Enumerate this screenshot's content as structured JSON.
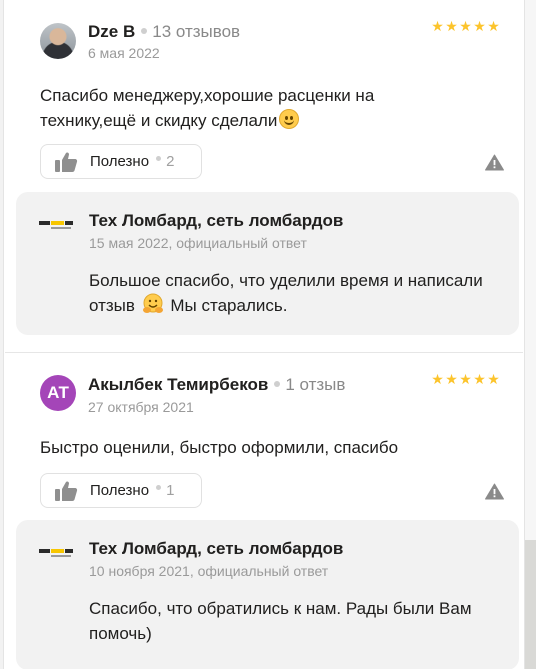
{
  "reviews": [
    {
      "author": "Dze B",
      "author_reviews": "13 отзывов",
      "date": "6 мая 2022",
      "rating": 5,
      "text": "Спасибо менеджеру,хорошие расценки на технику,ещё и скидку сделали",
      "text_emoji": "slightly-smiling-face",
      "useful_label": "Полезно",
      "useful_count": "2",
      "reply": {
        "org_name": "Тех Ломбард, сеть ломбардов",
        "date_line": "15 мая 2022, официальный ответ",
        "text_before": "Большое спасибо, что уделили время и написали отзыв",
        "text_emoji": "hugging-face",
        "text_after": "Мы старались."
      }
    },
    {
      "author": "Акылбек Темирбеков",
      "author_initials": "АТ",
      "author_reviews": "1 отзыв",
      "date": "27 октября 2021",
      "rating": 5,
      "text": "Быстро оценили, быстро оформили, спасибо",
      "useful_label": "Полезно",
      "useful_count": "1",
      "reply": {
        "org_name": "Тех Ломбард, сеть ломбардов",
        "date_line": "10 ноября 2021, официальный ответ",
        "text": "Спасибо, что обратились к нам. Рады были Вам помочь)"
      }
    }
  ],
  "colors": {
    "star": "#fcc42c",
    "avatar_initials_bg": "#a445b8",
    "reply_bg": "#f2f2f2",
    "muted_text": "#9a9a9a"
  },
  "icons": {
    "useful": "thumbs-up-icon",
    "report": "warning-triangle-icon",
    "org_logo": "tech-lombard-logo"
  }
}
